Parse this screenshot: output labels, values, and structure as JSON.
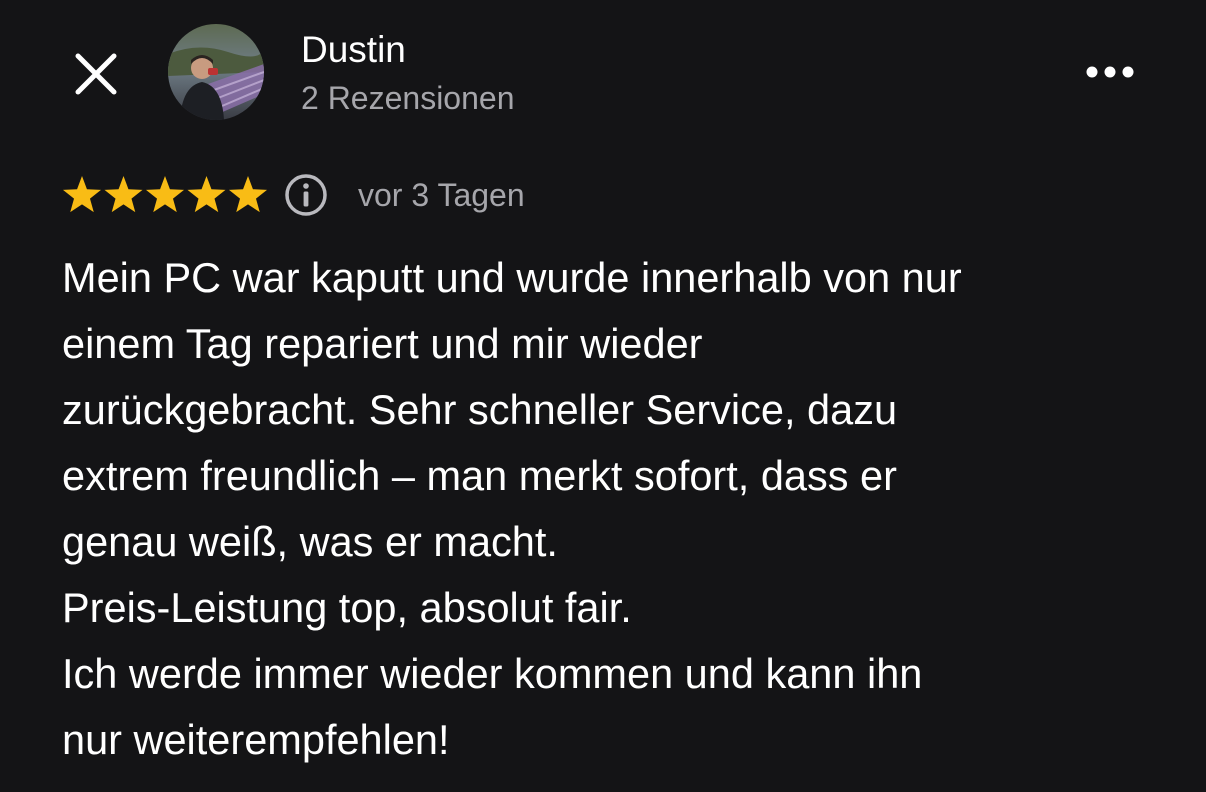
{
  "header": {
    "close_icon": "close-icon",
    "user_name": "Dustin",
    "review_count": "2 Rezensionen",
    "more_icon": "more-horizontal-icon"
  },
  "rating": {
    "stars": 5,
    "max_stars": 5,
    "star_color": "#f9bc15",
    "info_icon": "info-icon",
    "date": "vor 3 Tagen"
  },
  "review": {
    "lines": [
      "Mein PC war kaputt und wurde innerhalb von nur",
      "einem Tag repariert und mir wieder",
      "zurückgebracht. Sehr schneller Service, dazu",
      "extrem freundlich – man merkt sofort, dass er",
      "genau weiß, was er macht.",
      "Preis-Leistung top, absolut fair.",
      "Ich werde immer wieder kommen und kann ihn",
      "nur weiterempfehlen!"
    ]
  },
  "colors": {
    "background": "#141416",
    "primary_text": "#ffffff",
    "secondary_text": "#a6a6ab"
  }
}
